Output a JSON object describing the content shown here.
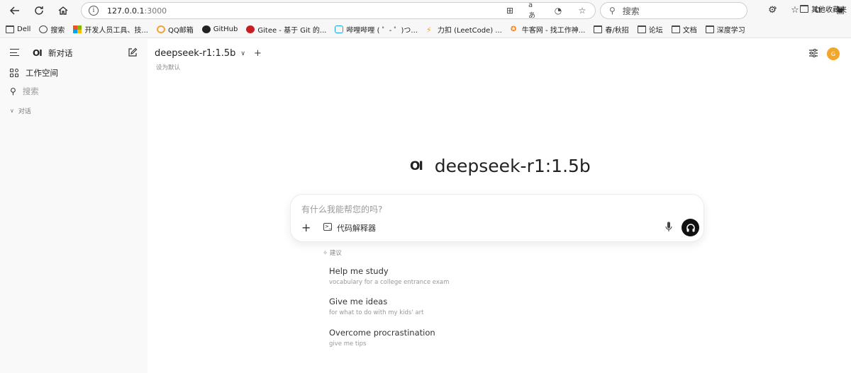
{
  "browser": {
    "url_host": "127.0.0.1",
    "url_port": ":3000",
    "search_placeholder": "搜索",
    "bookmarks": [
      {
        "label": "Dell",
        "icon": "folder-icon"
      },
      {
        "label": "搜索",
        "icon": "globe-icon"
      },
      {
        "label": "开发人员工具、技...",
        "icon": "microsoft-icon"
      },
      {
        "label": "QQ邮箱",
        "icon": "qq-mail-icon"
      },
      {
        "label": "GitHub",
        "icon": "github-icon"
      },
      {
        "label": "Gitee - 基于 Git 的...",
        "icon": "gitee-icon"
      },
      {
        "label": "哔哩哔哩 ( ゜- ゜)つ...",
        "icon": "bilibili-icon"
      },
      {
        "label": "力扣 (LeetCode) ...",
        "icon": "leetcode-icon"
      },
      {
        "label": "牛客网 - 找工作神...",
        "icon": "nowcoder-icon"
      },
      {
        "label": "春/秋招",
        "icon": "folder-icon"
      },
      {
        "label": "论坛",
        "icon": "folder-icon"
      },
      {
        "label": "文档",
        "icon": "folder-icon"
      },
      {
        "label": "深度学习",
        "icon": "folder-icon"
      }
    ],
    "other_bookmarks": "其他收藏夹"
  },
  "sidebar": {
    "logo": "OI",
    "new_chat": "新对话",
    "workspace": "工作空间",
    "search": "搜索",
    "chats_section": "对话"
  },
  "header": {
    "model": "deepseek-r1:1.5b",
    "set_default": "设为默认",
    "avatar": "G"
  },
  "hero": {
    "logo": "OI",
    "title": "deepseek-r1:1.5b"
  },
  "composer": {
    "placeholder": "有什么我能帮您的吗?",
    "code_interpreter": "代码解释器"
  },
  "suggestions": {
    "heading": "建议",
    "items": [
      {
        "title": "Help me study",
        "subtitle": "vocabulary for a college entrance exam"
      },
      {
        "title": "Give me ideas",
        "subtitle": "for what to do with my kids' art"
      },
      {
        "title": "Overcome procrastination",
        "subtitle": "give me tips"
      }
    ]
  }
}
